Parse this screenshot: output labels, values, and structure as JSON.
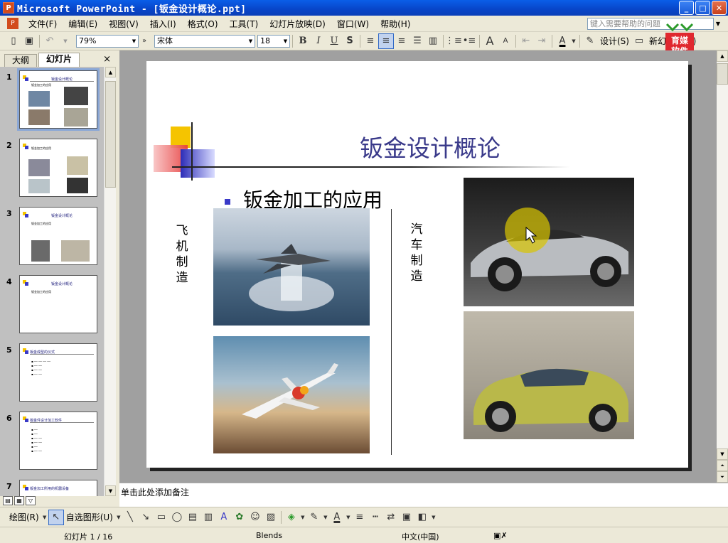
{
  "window": {
    "title": "Microsoft PowerPoint - [钣金设计概论.ppt]"
  },
  "menu": [
    "文件(F)",
    "编辑(E)",
    "视图(V)",
    "插入(I)",
    "格式(O)",
    "工具(T)",
    "幻灯片放映(D)",
    "窗口(W)",
    "帮助(H)"
  ],
  "help_box": {
    "placeholder": "键入需要帮助的问题"
  },
  "toolbar": {
    "zoom": "79%",
    "font": "宋体",
    "font_size": "18",
    "design_label": "设计(S)",
    "new_slide_label": "新幻灯片(N)"
  },
  "left_panel": {
    "tabs": [
      "大纲",
      "幻灯片"
    ],
    "close_symbol": "×",
    "thumbnails": [
      {
        "num": "1",
        "title": "钣金设计概论",
        "text": "钣金加工的应用"
      },
      {
        "num": "2",
        "title": "",
        "text": "钣金加工的应用"
      },
      {
        "num": "3",
        "title": "钣金设计概论",
        "text": "钣金加工的应用"
      },
      {
        "num": "4",
        "title": "钣金设计概论",
        "text": "钣金加工的应用"
      },
      {
        "num": "5",
        "title": "钣金成型的仪式",
        "text": ""
      },
      {
        "num": "6",
        "title": "钣金件设计加工软件",
        "text": ""
      },
      {
        "num": "7",
        "title": "钣金加工所用的机器设备",
        "text": ""
      }
    ]
  },
  "slide": {
    "title": "钣金设计概论",
    "bullet": "钣金加工的应用",
    "label_left": "飞机制造",
    "label_right": "汽车制造"
  },
  "notes": {
    "placeholder": "单击此处添加备注"
  },
  "drawbar": {
    "draw_label": "绘图(R)",
    "autoshape_label": "自选图形(U)"
  },
  "status": {
    "slide_pos": "幻灯片 1 / 16",
    "template": "Blends",
    "language": "中文(中国)"
  },
  "watermark": {
    "line1": "育媒",
    "line2": "软件"
  },
  "colors": {
    "title_blue": "#3a3a8a",
    "bullet_blue": "#3a3ac8",
    "accent_yellow": "#f5c400",
    "accent_red": "#e63a3a"
  }
}
